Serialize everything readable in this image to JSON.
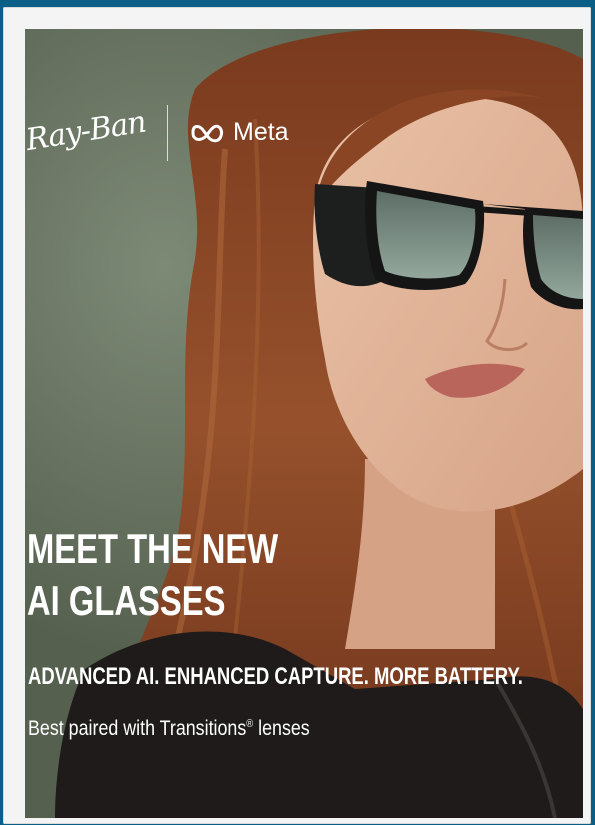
{
  "logo": {
    "brand_left": "Ray-Ban",
    "brand_right": "Meta",
    "meta_icon": "meta-infinity-icon"
  },
  "headline": {
    "line1": "MEET THE NEW",
    "line2": "AI GLASSES"
  },
  "subheadline": "ADVANCED AI. ENHANCED CAPTURE. MORE BATTERY.",
  "tagline": {
    "text": "Best paired with Transitions",
    "mark": "®",
    "suffix": " lenses"
  },
  "colors": {
    "frame_bg": "#0b5f86",
    "poster_border": "#f4f4f4",
    "backdrop": "#66725f",
    "hair": "#8a3f1f",
    "text": "#ffffff"
  }
}
